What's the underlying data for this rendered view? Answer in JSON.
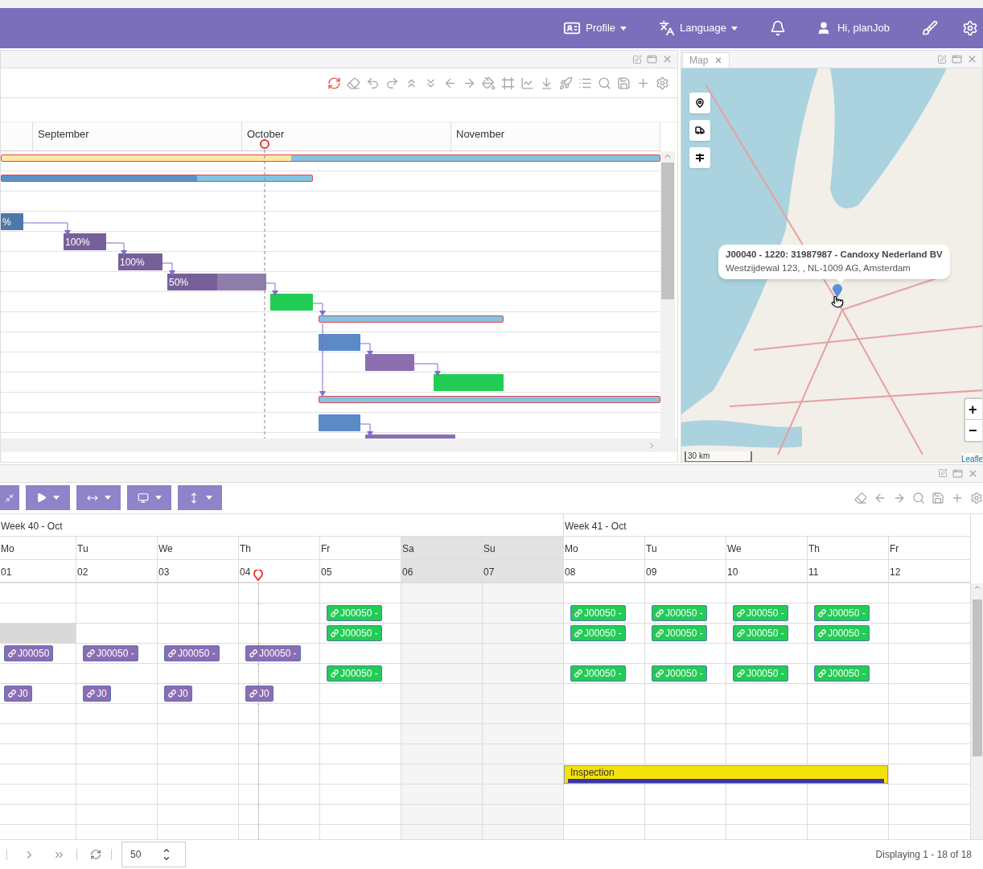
{
  "header": {
    "menus": [
      {
        "kind": "profile",
        "label": "Profile"
      },
      {
        "kind": "language",
        "label": "Language"
      }
    ],
    "user": "Hi, planJob"
  },
  "gantt": {
    "months": [
      "September",
      "October",
      "November"
    ],
    "rows": [
      {
        "kind": "summary",
        "color": "#fbe9a6",
        "level": 0.44
      },
      {
        "kind": "summary",
        "color": "#5e8fc2",
        "level": 0.63
      },
      {
        "kind": "empty"
      },
      {
        "kind": "task",
        "color": "#4e78a8",
        "label": "%",
        "level": 1
      },
      {
        "kind": "task",
        "color": "#77609a",
        "label": "100%",
        "level": 1
      },
      {
        "kind": "task",
        "color": "#77609a",
        "label": "100%",
        "level": 1
      },
      {
        "kind": "task",
        "color": "#77609a",
        "label": "50%",
        "level": 0.5
      },
      {
        "kind": "task",
        "color": "#22cc55"
      },
      {
        "kind": "summary"
      },
      {
        "kind": "task",
        "color": "#5b8ac6"
      },
      {
        "kind": "task",
        "color": "#8b6fb0"
      },
      {
        "kind": "task",
        "color": "#22cc55"
      },
      {
        "kind": "summary"
      },
      {
        "kind": "task",
        "color": "#5b8ac6"
      },
      {
        "kind": "task",
        "color": "#8b6fb0"
      }
    ]
  },
  "map": {
    "tab": "Map",
    "popup": {
      "title": "J00040 - 1220: 31987987 - Candoxy Nederland BV",
      "address": "Westzijdewal 123, , NL-1009 AG, Amsterdam"
    },
    "zoom_in": "+",
    "zoom_out": "−",
    "scale": "30 km",
    "attribution": "Leafle"
  },
  "scheduler": {
    "weeks": [
      {
        "label": "Week 40 - Oct",
        "days": [
          {
            "name": "Mo",
            "number": "01",
            "weekend": false,
            "today": false
          },
          {
            "name": "Tu",
            "number": "02",
            "weekend": false,
            "today": false
          },
          {
            "name": "We",
            "number": "03",
            "weekend": false,
            "today": false
          },
          {
            "name": "Th",
            "number": "04",
            "weekend": false,
            "today": true
          },
          {
            "name": "Fr",
            "number": "05",
            "weekend": false,
            "today": false
          },
          {
            "name": "Sa",
            "number": "06",
            "weekend": true,
            "today": false
          },
          {
            "name": "Su",
            "number": "07",
            "weekend": true,
            "today": false
          }
        ]
      },
      {
        "label": "Week 41 - Oct",
        "days": [
          {
            "name": "Mo",
            "number": "08",
            "weekend": false,
            "today": false
          },
          {
            "name": "Tu",
            "number": "09",
            "weekend": false,
            "today": false
          },
          {
            "name": "We",
            "number": "10",
            "weekend": false,
            "today": false
          },
          {
            "name": "Th",
            "number": "11",
            "weekend": false,
            "today": false
          },
          {
            "name": "Fr",
            "number": "12",
            "weekend": false,
            "today": false
          }
        ]
      }
    ],
    "rows": [
      {
        "cells": [
          null,
          null,
          null,
          null,
          null,
          null,
          null,
          null,
          null,
          null,
          null,
          null
        ]
      },
      {
        "cells": [
          null,
          null,
          null,
          null,
          {
            "kind": "job",
            "label": "J00050 -",
            "color": "#22cc55"
          },
          null,
          null,
          {
            "kind": "job",
            "label": "J00050 -",
            "color": "#22cc55"
          },
          {
            "kind": "job",
            "label": "J00050 -",
            "color": "#22cc55"
          },
          {
            "kind": "job",
            "label": "J00050 -",
            "color": "#22cc55"
          },
          {
            "kind": "job",
            "label": "J00050 -",
            "color": "#22cc55"
          },
          null
        ]
      },
      {
        "cells": [
          {
            "kind": "blocked"
          },
          null,
          null,
          null,
          {
            "kind": "job",
            "label": "J00050 -",
            "color": "#22cc55"
          },
          null,
          null,
          {
            "kind": "job",
            "label": "J00050 -",
            "color": "#22cc55"
          },
          {
            "kind": "job",
            "label": "J00050 -",
            "color": "#22cc55"
          },
          {
            "kind": "job",
            "label": "J00050 -",
            "color": "#22cc55"
          },
          {
            "kind": "job",
            "label": "J00050 -",
            "color": "#22cc55"
          },
          null
        ]
      },
      {
        "cells": [
          {
            "kind": "job",
            "label": "J00050",
            "color": "#8a6db3"
          },
          {
            "kind": "job",
            "label": "J00050 -",
            "color": "#8a6db3"
          },
          {
            "kind": "job",
            "label": "J00050 -",
            "color": "#8a6db3"
          },
          {
            "kind": "job",
            "label": "J00050 -",
            "color": "#8a6db3"
          },
          null,
          null,
          null,
          null,
          null,
          null,
          null,
          null
        ]
      },
      {
        "cells": [
          null,
          null,
          null,
          null,
          {
            "kind": "job",
            "label": "J00050 -",
            "color": "#22cc55"
          },
          null,
          null,
          {
            "kind": "job",
            "label": "J00050 -",
            "color": "#22cc55"
          },
          {
            "kind": "job",
            "label": "J00050 -",
            "color": "#22cc55"
          },
          {
            "kind": "job",
            "label": "J00050 -",
            "color": "#22cc55"
          },
          {
            "kind": "job",
            "label": "J00050 -",
            "color": "#22cc55"
          },
          null
        ]
      },
      {
        "cells": [
          {
            "kind": "job",
            "label": "J0",
            "color": "#8a6db3"
          },
          {
            "kind": "job",
            "label": "J0",
            "color": "#8a6db3"
          },
          {
            "kind": "job",
            "label": "J0",
            "color": "#8a6db3"
          },
          {
            "kind": "job",
            "label": "J0",
            "color": "#8a6db3"
          },
          null,
          null,
          null,
          null,
          null,
          null,
          null,
          null
        ]
      },
      {
        "cells": [
          null,
          null,
          null,
          null,
          null,
          null,
          null,
          null,
          null,
          null,
          null,
          null
        ]
      },
      {
        "cells": [
          null,
          null,
          null,
          null,
          null,
          null,
          null,
          null,
          null,
          null,
          null,
          null
        ]
      },
      {
        "cells": [
          null,
          null,
          null,
          null,
          null,
          null,
          null,
          null,
          null,
          null,
          null,
          null
        ]
      },
      {
        "cells": [
          null,
          null,
          null,
          null,
          null,
          null,
          null,
          {
            "kind": "bar",
            "label": "Inspection",
            "color": "#f5e10a"
          },
          {
            "kind": "bar_continued"
          },
          {
            "kind": "bar_continued"
          },
          {
            "kind": "bar_continued"
          },
          null
        ]
      },
      {
        "cells": [
          null,
          null,
          null,
          null,
          null,
          null,
          null,
          null,
          null,
          null,
          null,
          null
        ]
      },
      {
        "cells": [
          null,
          null,
          null,
          null,
          null,
          null,
          null,
          null,
          null,
          null,
          null,
          null
        ]
      },
      {
        "cells": [
          null,
          null,
          null,
          null,
          null,
          null,
          null,
          null,
          null,
          null,
          null,
          null
        ]
      }
    ]
  },
  "footer": {
    "page_size": "50",
    "summary": "Displaying 1 - 18 of 18"
  }
}
